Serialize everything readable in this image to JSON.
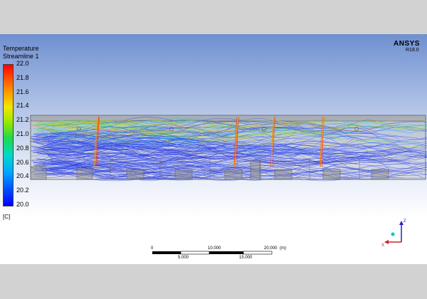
{
  "legend": {
    "variable": "Temperature",
    "object": "Streamline 1",
    "ticks": [
      "22.0",
      "21.8",
      "21.6",
      "21.4",
      "21.2",
      "21.0",
      "20.8",
      "20.6",
      "20.4",
      "20.2",
      "20.0"
    ],
    "unit": "[C]"
  },
  "brand": {
    "name": "ANSYS",
    "version": "R18.0"
  },
  "scale_bar": {
    "top_labels": [
      "0",
      "10.000",
      "20.000"
    ],
    "unit": "(m)",
    "bottom_labels": [
      "5.000",
      "15.000"
    ]
  },
  "axis": {
    "z": "Z",
    "x": "X"
  },
  "colors": {
    "hot": "#ff0000",
    "cold": "#0000ff",
    "background_top": "#6f8fd0"
  },
  "icons": [
    "triad-icon"
  ]
}
